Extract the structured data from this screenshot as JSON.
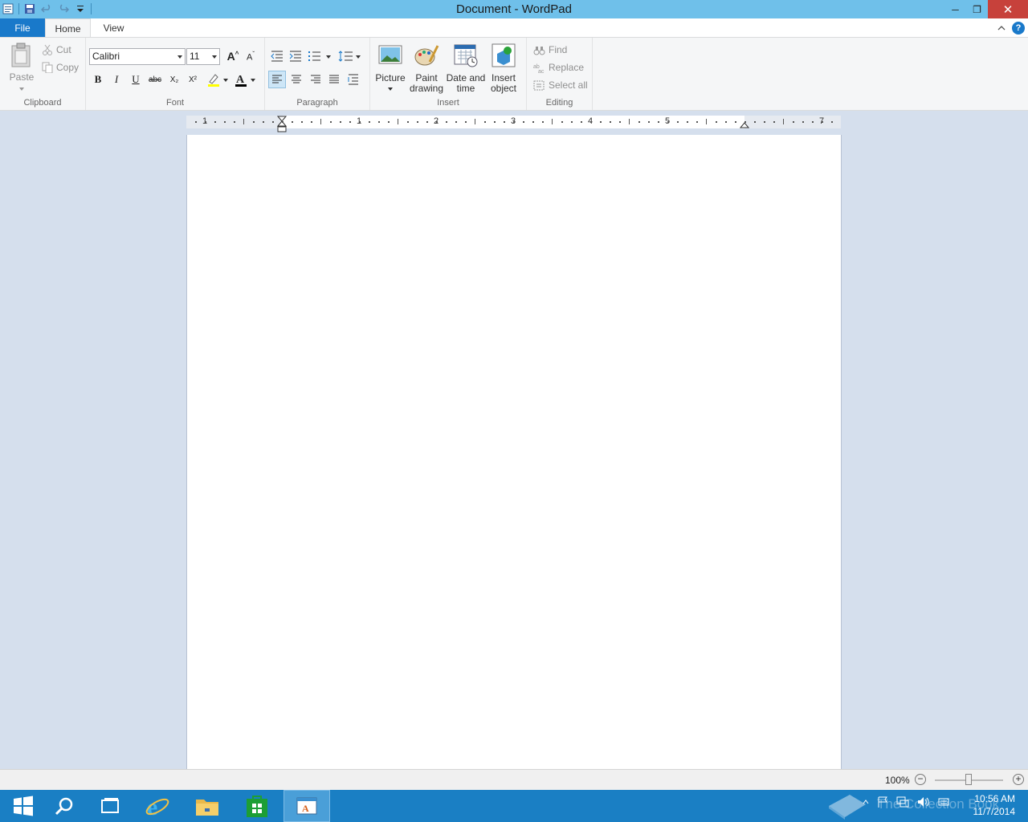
{
  "window": {
    "title": "Document - WordPad",
    "controls": {
      "minimize": "─",
      "maximize": "❐",
      "close": "✕"
    }
  },
  "tabs": {
    "file": "File",
    "home": "Home",
    "view": "View"
  },
  "clipboard": {
    "paste": "Paste",
    "cut": "Cut",
    "copy": "Copy",
    "group": "Clipboard"
  },
  "font": {
    "family": "Calibri",
    "size": "11",
    "group": "Font"
  },
  "paragraph": {
    "group": "Paragraph"
  },
  "insert": {
    "picture": "Picture",
    "paint_line1": "Paint",
    "paint_line2": "drawing",
    "date_line1": "Date and",
    "date_line2": "time",
    "object_line1": "Insert",
    "object_line2": "object",
    "group": "Insert"
  },
  "editing": {
    "find": "Find",
    "replace": "Replace",
    "select_all": "Select all",
    "group": "Editing"
  },
  "ruler": {
    "numbers": [
      "1",
      "1",
      "2",
      "3",
      "4",
      "5",
      "7"
    ]
  },
  "status": {
    "zoom": "100%"
  },
  "taskbar": {
    "time": "10:56 AM",
    "date": "11/7/2014",
    "watermark": "The Collection Book"
  },
  "icons": {
    "format_bold": "B",
    "format_italic": "I",
    "format_underline": "U",
    "format_strike": "abc",
    "format_sub": "X₂",
    "format_sup": "X²",
    "font_color_letter": "A",
    "grow_font_letter": "A",
    "shrink_font_letter": "A"
  },
  "colors": {
    "titlebar": "#6fc0ea",
    "file_tab": "#1979ca",
    "taskbar": "#1a7fc4",
    "close": "#c7413b",
    "font_color": "#000000",
    "highlight": "#ffff00"
  }
}
